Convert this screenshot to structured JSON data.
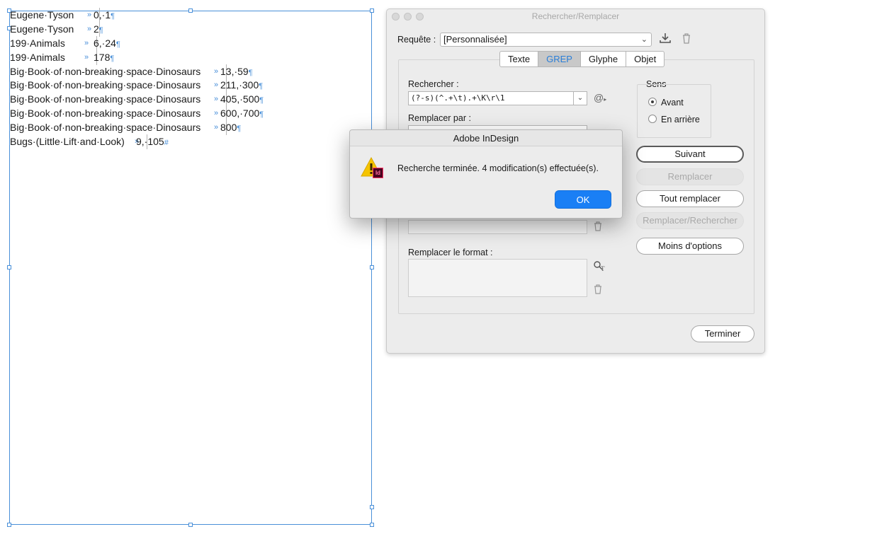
{
  "document": {
    "lines": [
      {
        "title": "Eugene·Tyson",
        "tab": "»",
        "pages": "0,·1",
        "mark": "¶"
      },
      {
        "title": "Eugene·Tyson",
        "tab": "»",
        "pages": "2",
        "mark": "¶"
      },
      {
        "title": "199·Animals",
        "tab": "»",
        "pages": "6,·24",
        "mark": "¶"
      },
      {
        "title": "199·Animals",
        "tab": "»",
        "pages": "178",
        "mark": "¶"
      },
      {
        "title": "Big·Book·of·non-breaking·space·Dinosaurs",
        "tab": "»",
        "pages": "13,·59",
        "mark": "¶"
      },
      {
        "title": "Big·Book·of·non-breaking·space·Dinosaurs",
        "tab": "»",
        "pages": "211,·300",
        "mark": "¶"
      },
      {
        "title": "Big·Book·of·non-breaking·space·Dinosaurs",
        "tab": "»",
        "pages": "405,·500",
        "mark": "¶"
      },
      {
        "title": "Big·Book·of·non-breaking·space·Dinosaurs",
        "tab": "»",
        "pages": "600,·700",
        "mark": "¶"
      },
      {
        "title": "Big·Book·of·non-breaking·space·Dinosaurs",
        "tab": "»",
        "pages": "800",
        "mark": "¶"
      },
      {
        "title": "Bugs·(Little·Lift·and·Look)",
        "tab": "»",
        "pages": "9,·105",
        "mark": "#"
      }
    ]
  },
  "panel": {
    "title": "Rechercher/Remplacer",
    "query_label": "Requête :",
    "query_value": "[Personnalisée]",
    "tabs": [
      {
        "label": "Texte",
        "active": false
      },
      {
        "label": "GREP",
        "active": true
      },
      {
        "label": "Glyphe",
        "active": false
      },
      {
        "label": "Objet",
        "active": false
      }
    ],
    "find_label": "Rechercher :",
    "find_value": "(?-s)(^.+\\t).+\\K\\r\\1",
    "change_label": "Remplacer par :",
    "change_format_label": "Remplacer le format :",
    "direction": {
      "label": "Sens",
      "options": [
        {
          "label": "Avant",
          "selected": true
        },
        {
          "label": "En arrière",
          "selected": false
        }
      ]
    },
    "buttons": {
      "next": "Suivant",
      "replace": "Remplacer",
      "replace_all": "Tout remplacer",
      "replace_find": "Remplacer/Rechercher",
      "fewer_options": "Moins d'options",
      "done": "Terminer"
    }
  },
  "alert": {
    "title": "Adobe InDesign",
    "message": "Recherche terminée.  4 modification(s) effectuée(s).",
    "ok": "OK",
    "badge": "Id"
  },
  "colors": {
    "accent": "#1a7ff5",
    "frame": "#4a90d9",
    "warning": "#f5c400",
    "indesign_badge": "#49021f"
  }
}
